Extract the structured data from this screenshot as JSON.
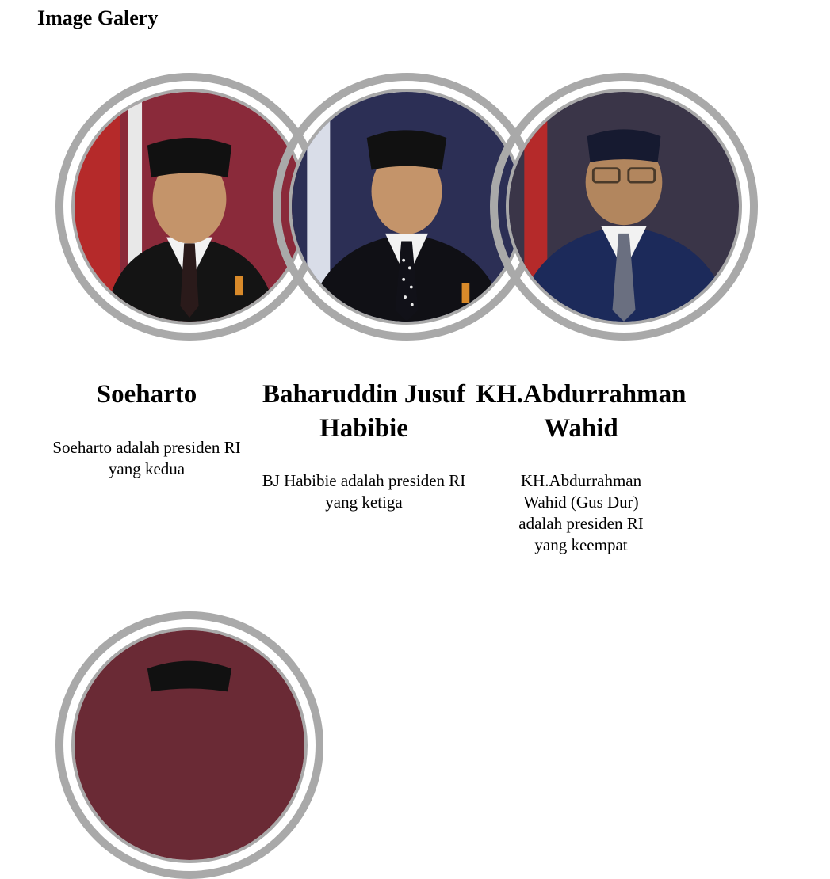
{
  "page": {
    "title": "Image Galery"
  },
  "gallery": [
    {
      "name": "Soeharto",
      "description": "Soeharto adalah presiden RI yang kedua",
      "backdrop_color": "#8a2a3a",
      "suit_color": "#141414",
      "tie_color": "#2a1a1a",
      "icon": "portrait-soeharto"
    },
    {
      "name": "Baharuddin Jusuf Habibie",
      "description": "BJ Habibie adalah presiden RI yang ketiga",
      "backdrop_color": "#2c2f55",
      "suit_color": "#101015",
      "tie_color": "#111118",
      "icon": "portrait-habibie"
    },
    {
      "name": "KH.Abdurrahman Wahid",
      "description": "KH.Abdurrahman Wahid (Gus Dur) adalah presiden RI yang keempat",
      "backdrop_color": "#3a3548",
      "suit_color": "#1c2a5a",
      "tie_color": "#6a6f80",
      "icon": "portrait-gus-dur"
    },
    {
      "name": "",
      "description": "",
      "backdrop_color": "#6a2a35",
      "suit_color": "#141414",
      "tie_color": "#2a1a1a",
      "icon": "portrait-next"
    }
  ],
  "colors": {
    "frame_ring": "#a9a9a9",
    "skin": "#c4946a",
    "peci": "#111111",
    "shirt": "#f2f2f2"
  }
}
